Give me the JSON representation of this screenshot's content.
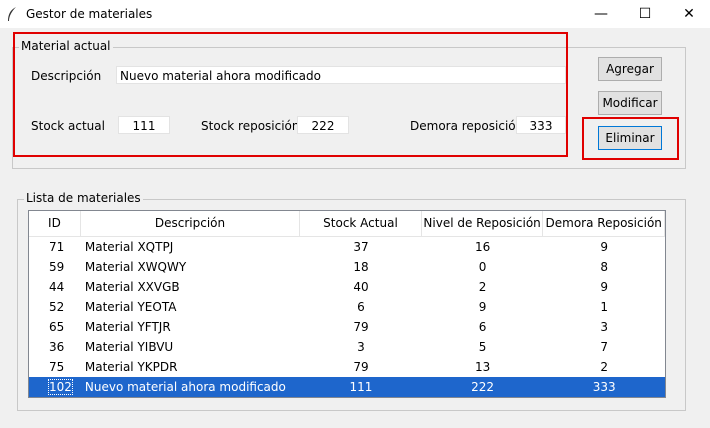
{
  "window": {
    "title": "Gestor de materiales",
    "minimize": "—",
    "maximize": "☐",
    "close": "✕"
  },
  "form": {
    "group_title": "Material actual",
    "descripcion_label": "Descripción",
    "descripcion_value": "Nuevo  material ahora modificado",
    "stock_actual_label": "Stock actual",
    "stock_actual_value": "111",
    "stock_reposicion_label": "Stock reposición",
    "stock_reposicion_value": "222",
    "demora_label": "Demora reposición",
    "demora_value": "333"
  },
  "buttons": {
    "agregar": "Agregar",
    "modificar": "Modificar",
    "eliminar": "Eliminar"
  },
  "list": {
    "group_title": "Lista de materiales",
    "columns": [
      "ID",
      "Descripción",
      "Stock Actual",
      "Nivel de Reposición",
      "Demora Reposición"
    ],
    "rows": [
      [
        "71",
        "Material XQTPJ",
        "37",
        "16",
        "9"
      ],
      [
        "59",
        "Material XWQWY",
        "18",
        "0",
        "8"
      ],
      [
        "44",
        "Material XXVGB",
        "40",
        "2",
        "9"
      ],
      [
        "52",
        "Material YEOTA",
        "6",
        "9",
        "1"
      ],
      [
        "65",
        "Material YFTJR",
        "79",
        "6",
        "3"
      ],
      [
        "36",
        "Material YIBVU",
        "3",
        "5",
        "7"
      ],
      [
        "75",
        "Material YKPDR",
        "79",
        "13",
        "2"
      ],
      [
        "102",
        "Nuevo  material ahora modificado",
        "111",
        "222",
        "333"
      ]
    ],
    "selected_id": "102"
  },
  "annotation_color": "#e00000",
  "selection_color": "#1e66cc"
}
